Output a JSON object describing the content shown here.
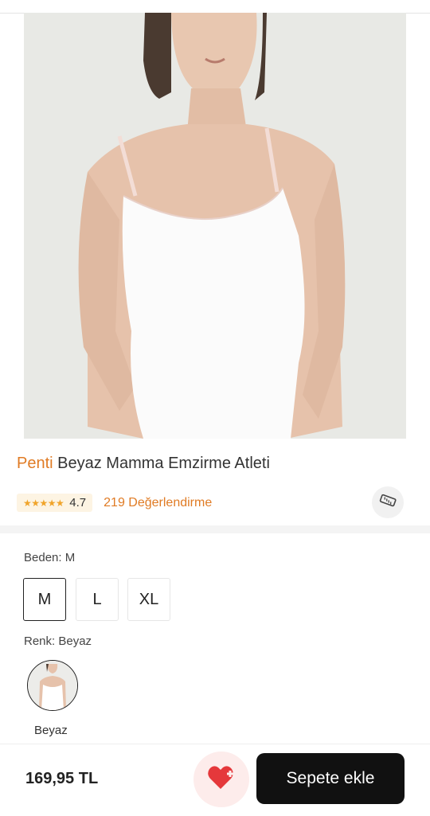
{
  "product": {
    "brand": "Penti",
    "name": "Beyaz Mamma Emzirme Atleti",
    "image_alt_icon": "product-photo"
  },
  "rating": {
    "stars": "★★★★★",
    "value": "4.7",
    "reviews_label": "219 Değerlendirme",
    "star_color": "#f0a42a"
  },
  "size_guide": {
    "icon": "ruler-icon"
  },
  "size_section": {
    "label": "Beden: M",
    "options": [
      "M",
      "L",
      "XL"
    ],
    "selected": "M"
  },
  "color_section": {
    "label": "Renk: Beyaz",
    "swatches": [
      {
        "label": "Beyaz",
        "selected": true
      }
    ]
  },
  "bottom_bar": {
    "price": "169,95 TL",
    "add_to_cart": "Sepete ekle",
    "favorite_icon": "heart-plus-icon",
    "accent": "#e5383b"
  },
  "colors": {
    "brand": "#e07b24",
    "button": "#111111"
  }
}
